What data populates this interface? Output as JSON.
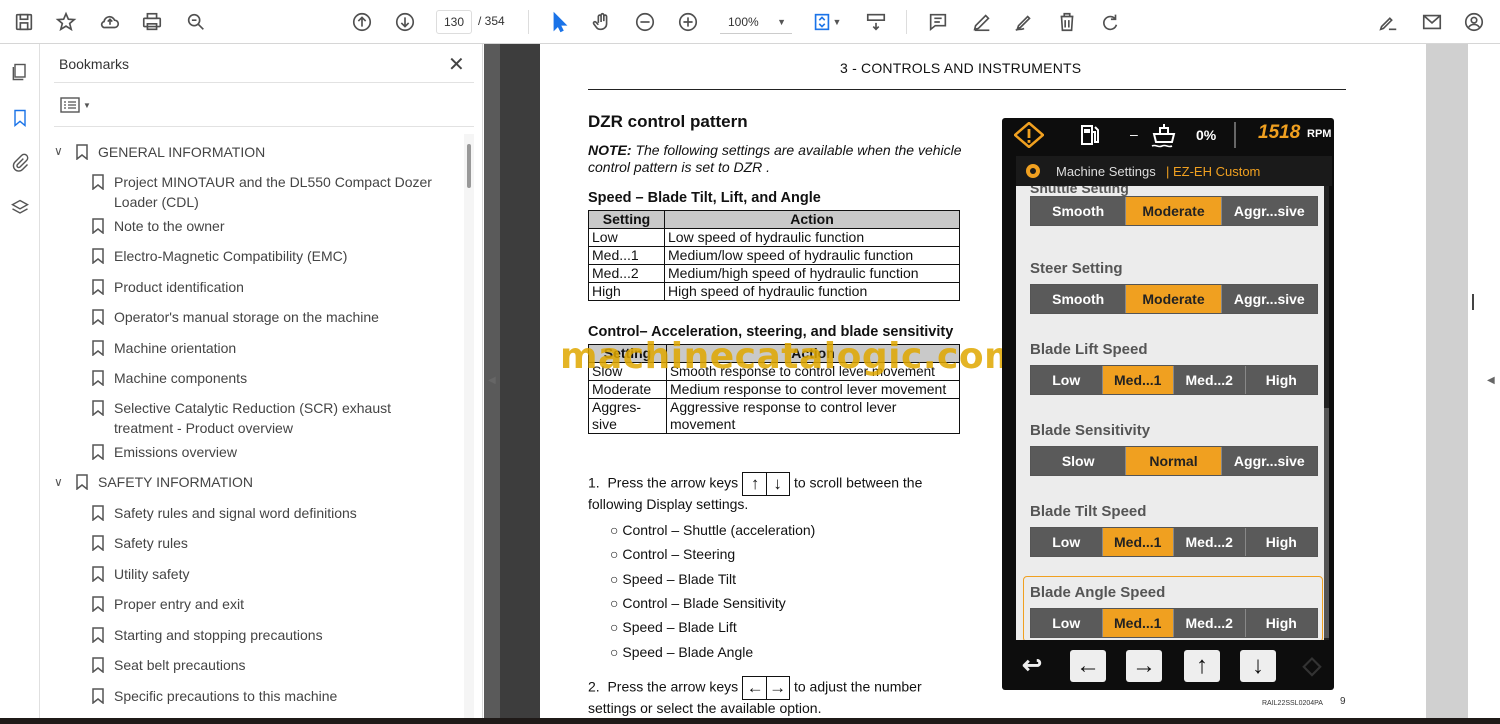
{
  "toolbar": {
    "page_current": "130",
    "page_total": "/ 354",
    "zoom": "100%"
  },
  "bookmarks": {
    "title": "Bookmarks",
    "items": [
      {
        "label": "GENERAL INFORMATION"
      },
      {
        "label": "Project MINOTAUR and the DL550 Compact Dozer Loader (CDL)"
      },
      {
        "label": "Note to the owner"
      },
      {
        "label": "Electro-Magnetic Compatibility (EMC)"
      },
      {
        "label": "Product identification"
      },
      {
        "label": "Operator's manual storage on the machine"
      },
      {
        "label": "Machine orientation"
      },
      {
        "label": "Machine components"
      },
      {
        "label": "Selective Catalytic Reduction (SCR) exhaust treatment - Product overview"
      },
      {
        "label": "Emissions overview"
      },
      {
        "label": "SAFETY INFORMATION"
      },
      {
        "label": "Safety rules and signal word definitions"
      },
      {
        "label": "Safety rules"
      },
      {
        "label": "Utility safety"
      },
      {
        "label": "Proper entry and exit"
      },
      {
        "label": "Starting and stopping precautions"
      },
      {
        "label": "Seat belt precautions"
      },
      {
        "label": "Specific precautions to this machine"
      }
    ]
  },
  "page": {
    "header": "3 - CONTROLS AND INSTRUMENTS",
    "title": "DZR control pattern",
    "note_label": "NOTE:",
    "note_text": " The following settings are available when the vehicle control pattern is set to DZR .",
    "speed_heading": "Speed – Blade Tilt, Lift, and Angle",
    "speed_table": {
      "headers": [
        "Setting",
        "Action"
      ],
      "rows": [
        [
          "Low",
          "Low speed of hydraulic function"
        ],
        [
          "Med...1",
          "Medium/low speed of hydraulic function"
        ],
        [
          "Med...2",
          "Medium/high speed of hydraulic function"
        ],
        [
          "High",
          "High speed of hydraulic function"
        ]
      ]
    },
    "control_heading": "Control– Acceleration, steering, and blade sensitivity",
    "control_table": {
      "headers": [
        "Setting",
        "Action"
      ],
      "rows": [
        [
          "Slow",
          "Smooth response to control lever movement"
        ],
        [
          "Moderate",
          "Medium response to control lever movement"
        ],
        [
          "Aggres-sive",
          "Aggressive response to control lever movement"
        ]
      ]
    },
    "watermark": "machinecatalogic.com",
    "step1_num": "1.",
    "step1_pre": "Press the arrow keys",
    "step1_post": "to scroll between the following Display settings.",
    "bullets": [
      "Control – Shuttle (acceleration)",
      "Control – Steering",
      "Speed – Blade Tilt",
      "Control – Blade Sensitivity",
      "Speed – Blade Lift",
      "Speed – Blade Angle"
    ],
    "step2_num": "2.",
    "step2_pre": "Press the arrow keys",
    "step2_post": "to adjust the number settings or select the available option.",
    "footer_code": "RAIL22SSL0204PA",
    "footer_page": "9"
  },
  "display": {
    "fuel_dash": "–",
    "percent": "0%",
    "rpm_value": "1518",
    "rpm_unit": "RPM",
    "menu_title": "Machine Settings",
    "menu_mode": "| EZ-EH Custom",
    "settings": [
      {
        "label": "Shuttle Setting",
        "options": [
          "Smooth",
          "Moderate",
          "Aggr...sive"
        ],
        "selected": 1
      },
      {
        "label": "Steer Setting",
        "options": [
          "Smooth",
          "Moderate",
          "Aggr...sive"
        ],
        "selected": 1
      },
      {
        "label": "Blade Lift Speed",
        "options": [
          "Low",
          "Med...1",
          "Med...2",
          "High"
        ],
        "selected": 1
      },
      {
        "label": "Blade Sensitivity",
        "options": [
          "Slow",
          "Normal",
          "Aggr...sive"
        ],
        "selected": 1
      },
      {
        "label": "Blade Tilt Speed",
        "options": [
          "Low",
          "Med...1",
          "Med...2",
          "High"
        ],
        "selected": 1
      },
      {
        "label": "Blade Angle Speed",
        "options": [
          "Low",
          "Med...1",
          "Med...2",
          "High"
        ],
        "selected": 1
      }
    ],
    "accent_color": "#f0a020"
  }
}
